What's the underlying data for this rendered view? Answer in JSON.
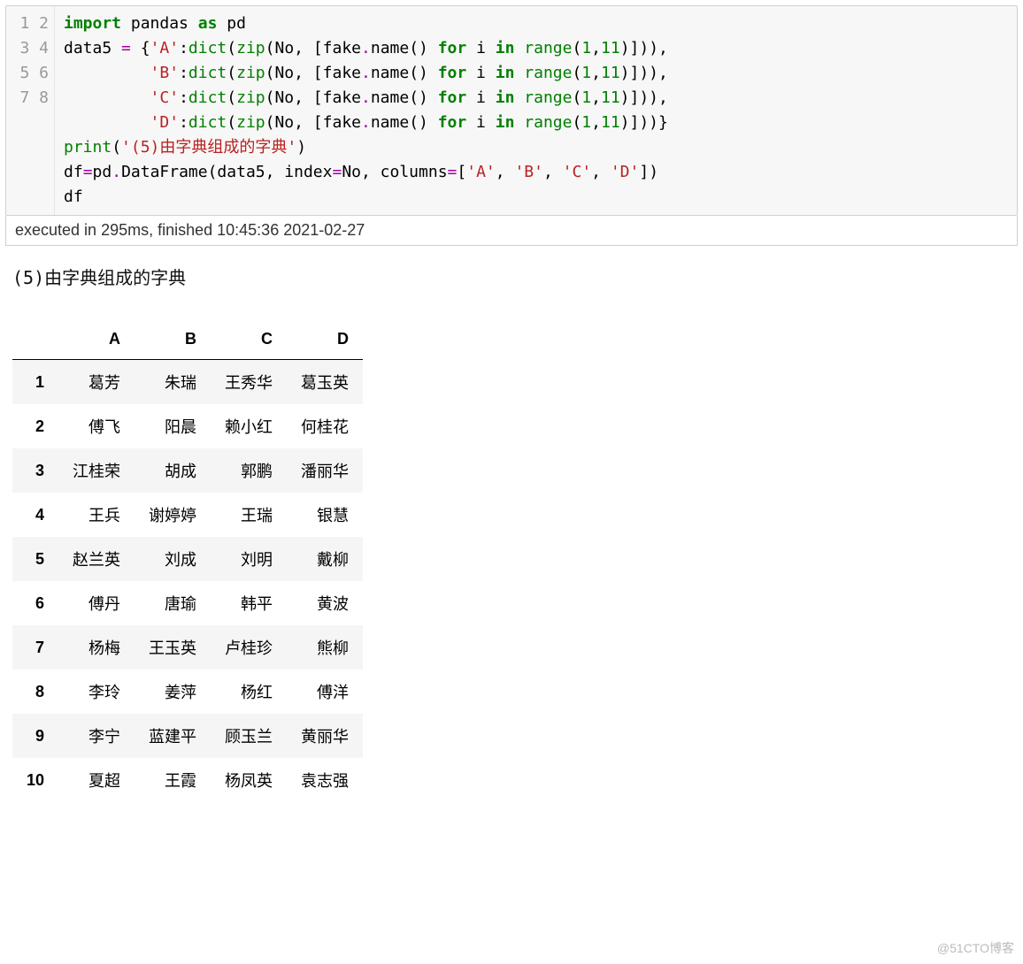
{
  "code": {
    "line_numbers": [
      "1",
      "2",
      "3",
      "4",
      "5",
      "6",
      "7",
      "8"
    ],
    "tokens": [
      [
        {
          "t": "import",
          "c": "tok-kw"
        },
        {
          "t": " pandas ",
          "c": "tok-name"
        },
        {
          "t": "as",
          "c": "tok-kw"
        },
        {
          "t": " pd",
          "c": "tok-name"
        }
      ],
      [
        {
          "t": "data5 ",
          "c": "tok-name"
        },
        {
          "t": "=",
          "c": "tok-op"
        },
        {
          "t": " {",
          "c": "tok-name"
        },
        {
          "t": "'A'",
          "c": "tok-str"
        },
        {
          "t": ":",
          "c": "tok-name"
        },
        {
          "t": "dict",
          "c": "tok-func"
        },
        {
          "t": "(",
          "c": "tok-name"
        },
        {
          "t": "zip",
          "c": "tok-func"
        },
        {
          "t": "(No, [fake",
          "c": "tok-name"
        },
        {
          "t": ".",
          "c": "tok-op"
        },
        {
          "t": "name() ",
          "c": "tok-name"
        },
        {
          "t": "for",
          "c": "tok-kw"
        },
        {
          "t": " i ",
          "c": "tok-name"
        },
        {
          "t": "in",
          "c": "tok-kw"
        },
        {
          "t": " ",
          "c": "tok-name"
        },
        {
          "t": "range",
          "c": "tok-func"
        },
        {
          "t": "(",
          "c": "tok-name"
        },
        {
          "t": "1",
          "c": "tok-num"
        },
        {
          "t": ",",
          "c": "tok-name"
        },
        {
          "t": "11",
          "c": "tok-num"
        },
        {
          "t": ")])),",
          "c": "tok-name"
        }
      ],
      [
        {
          "t": "         ",
          "c": "tok-name"
        },
        {
          "t": "'B'",
          "c": "tok-str"
        },
        {
          "t": ":",
          "c": "tok-name"
        },
        {
          "t": "dict",
          "c": "tok-func"
        },
        {
          "t": "(",
          "c": "tok-name"
        },
        {
          "t": "zip",
          "c": "tok-func"
        },
        {
          "t": "(No, [fake",
          "c": "tok-name"
        },
        {
          "t": ".",
          "c": "tok-op"
        },
        {
          "t": "name() ",
          "c": "tok-name"
        },
        {
          "t": "for",
          "c": "tok-kw"
        },
        {
          "t": " i ",
          "c": "tok-name"
        },
        {
          "t": "in",
          "c": "tok-kw"
        },
        {
          "t": " ",
          "c": "tok-name"
        },
        {
          "t": "range",
          "c": "tok-func"
        },
        {
          "t": "(",
          "c": "tok-name"
        },
        {
          "t": "1",
          "c": "tok-num"
        },
        {
          "t": ",",
          "c": "tok-name"
        },
        {
          "t": "11",
          "c": "tok-num"
        },
        {
          "t": ")])),",
          "c": "tok-name"
        }
      ],
      [
        {
          "t": "         ",
          "c": "tok-name"
        },
        {
          "t": "'C'",
          "c": "tok-str"
        },
        {
          "t": ":",
          "c": "tok-name"
        },
        {
          "t": "dict",
          "c": "tok-func"
        },
        {
          "t": "(",
          "c": "tok-name"
        },
        {
          "t": "zip",
          "c": "tok-func"
        },
        {
          "t": "(No, [fake",
          "c": "tok-name"
        },
        {
          "t": ".",
          "c": "tok-op"
        },
        {
          "t": "name() ",
          "c": "tok-name"
        },
        {
          "t": "for",
          "c": "tok-kw"
        },
        {
          "t": " i ",
          "c": "tok-name"
        },
        {
          "t": "in",
          "c": "tok-kw"
        },
        {
          "t": " ",
          "c": "tok-name"
        },
        {
          "t": "range",
          "c": "tok-func"
        },
        {
          "t": "(",
          "c": "tok-name"
        },
        {
          "t": "1",
          "c": "tok-num"
        },
        {
          "t": ",",
          "c": "tok-name"
        },
        {
          "t": "11",
          "c": "tok-num"
        },
        {
          "t": ")])),",
          "c": "tok-name"
        }
      ],
      [
        {
          "t": "         ",
          "c": "tok-name"
        },
        {
          "t": "'D'",
          "c": "tok-str"
        },
        {
          "t": ":",
          "c": "tok-name"
        },
        {
          "t": "dict",
          "c": "tok-func"
        },
        {
          "t": "(",
          "c": "tok-name"
        },
        {
          "t": "zip",
          "c": "tok-func"
        },
        {
          "t": "(No, [fake",
          "c": "tok-name"
        },
        {
          "t": ".",
          "c": "tok-op"
        },
        {
          "t": "name() ",
          "c": "tok-name"
        },
        {
          "t": "for",
          "c": "tok-kw"
        },
        {
          "t": " i ",
          "c": "tok-name"
        },
        {
          "t": "in",
          "c": "tok-kw"
        },
        {
          "t": " ",
          "c": "tok-name"
        },
        {
          "t": "range",
          "c": "tok-func"
        },
        {
          "t": "(",
          "c": "tok-name"
        },
        {
          "t": "1",
          "c": "tok-num"
        },
        {
          "t": ",",
          "c": "tok-name"
        },
        {
          "t": "11",
          "c": "tok-num"
        },
        {
          "t": ")]))}",
          "c": "tok-name"
        }
      ],
      [
        {
          "t": "print",
          "c": "tok-func"
        },
        {
          "t": "(",
          "c": "tok-name"
        },
        {
          "t": "'(5)由字典组成的字典'",
          "c": "tok-str"
        },
        {
          "t": ")",
          "c": "tok-name"
        }
      ],
      [
        {
          "t": "df",
          "c": "tok-name"
        },
        {
          "t": "=",
          "c": "tok-op"
        },
        {
          "t": "pd",
          "c": "tok-name"
        },
        {
          "t": ".",
          "c": "tok-op"
        },
        {
          "t": "DataFrame(data5, index",
          "c": "tok-name"
        },
        {
          "t": "=",
          "c": "tok-op"
        },
        {
          "t": "No, columns",
          "c": "tok-name"
        },
        {
          "t": "=",
          "c": "tok-op"
        },
        {
          "t": "[",
          "c": "tok-name"
        },
        {
          "t": "'A'",
          "c": "tok-str"
        },
        {
          "t": ", ",
          "c": "tok-name"
        },
        {
          "t": "'B'",
          "c": "tok-str"
        },
        {
          "t": ", ",
          "c": "tok-name"
        },
        {
          "t": "'C'",
          "c": "tok-str"
        },
        {
          "t": ", ",
          "c": "tok-name"
        },
        {
          "t": "'D'",
          "c": "tok-str"
        },
        {
          "t": "])",
          "c": "tok-name"
        }
      ],
      [
        {
          "t": "df",
          "c": "tok-name"
        }
      ]
    ]
  },
  "exec_status": "executed in 295ms, finished 10:45:36 2021-02-27",
  "print_output": "(5)由字典组成的字典",
  "dataframe": {
    "columns": [
      "A",
      "B",
      "C",
      "D"
    ],
    "index": [
      "1",
      "2",
      "3",
      "4",
      "5",
      "6",
      "7",
      "8",
      "9",
      "10"
    ],
    "rows": [
      [
        "葛芳",
        "朱瑞",
        "王秀华",
        "葛玉英"
      ],
      [
        "傅飞",
        "阳晨",
        "赖小红",
        "何桂花"
      ],
      [
        "江桂荣",
        "胡成",
        "郭鹏",
        "潘丽华"
      ],
      [
        "王兵",
        "谢婷婷",
        "王瑞",
        "银慧"
      ],
      [
        "赵兰英",
        "刘成",
        "刘明",
        "戴柳"
      ],
      [
        "傅丹",
        "唐瑜",
        "韩平",
        "黄波"
      ],
      [
        "杨梅",
        "王玉英",
        "卢桂珍",
        "熊柳"
      ],
      [
        "李玲",
        "姜萍",
        "杨红",
        "傅洋"
      ],
      [
        "李宁",
        "蓝建平",
        "顾玉兰",
        "黄丽华"
      ],
      [
        "夏超",
        "王霞",
        "杨凤英",
        "袁志强"
      ]
    ]
  },
  "watermark": "@51CTO博客"
}
